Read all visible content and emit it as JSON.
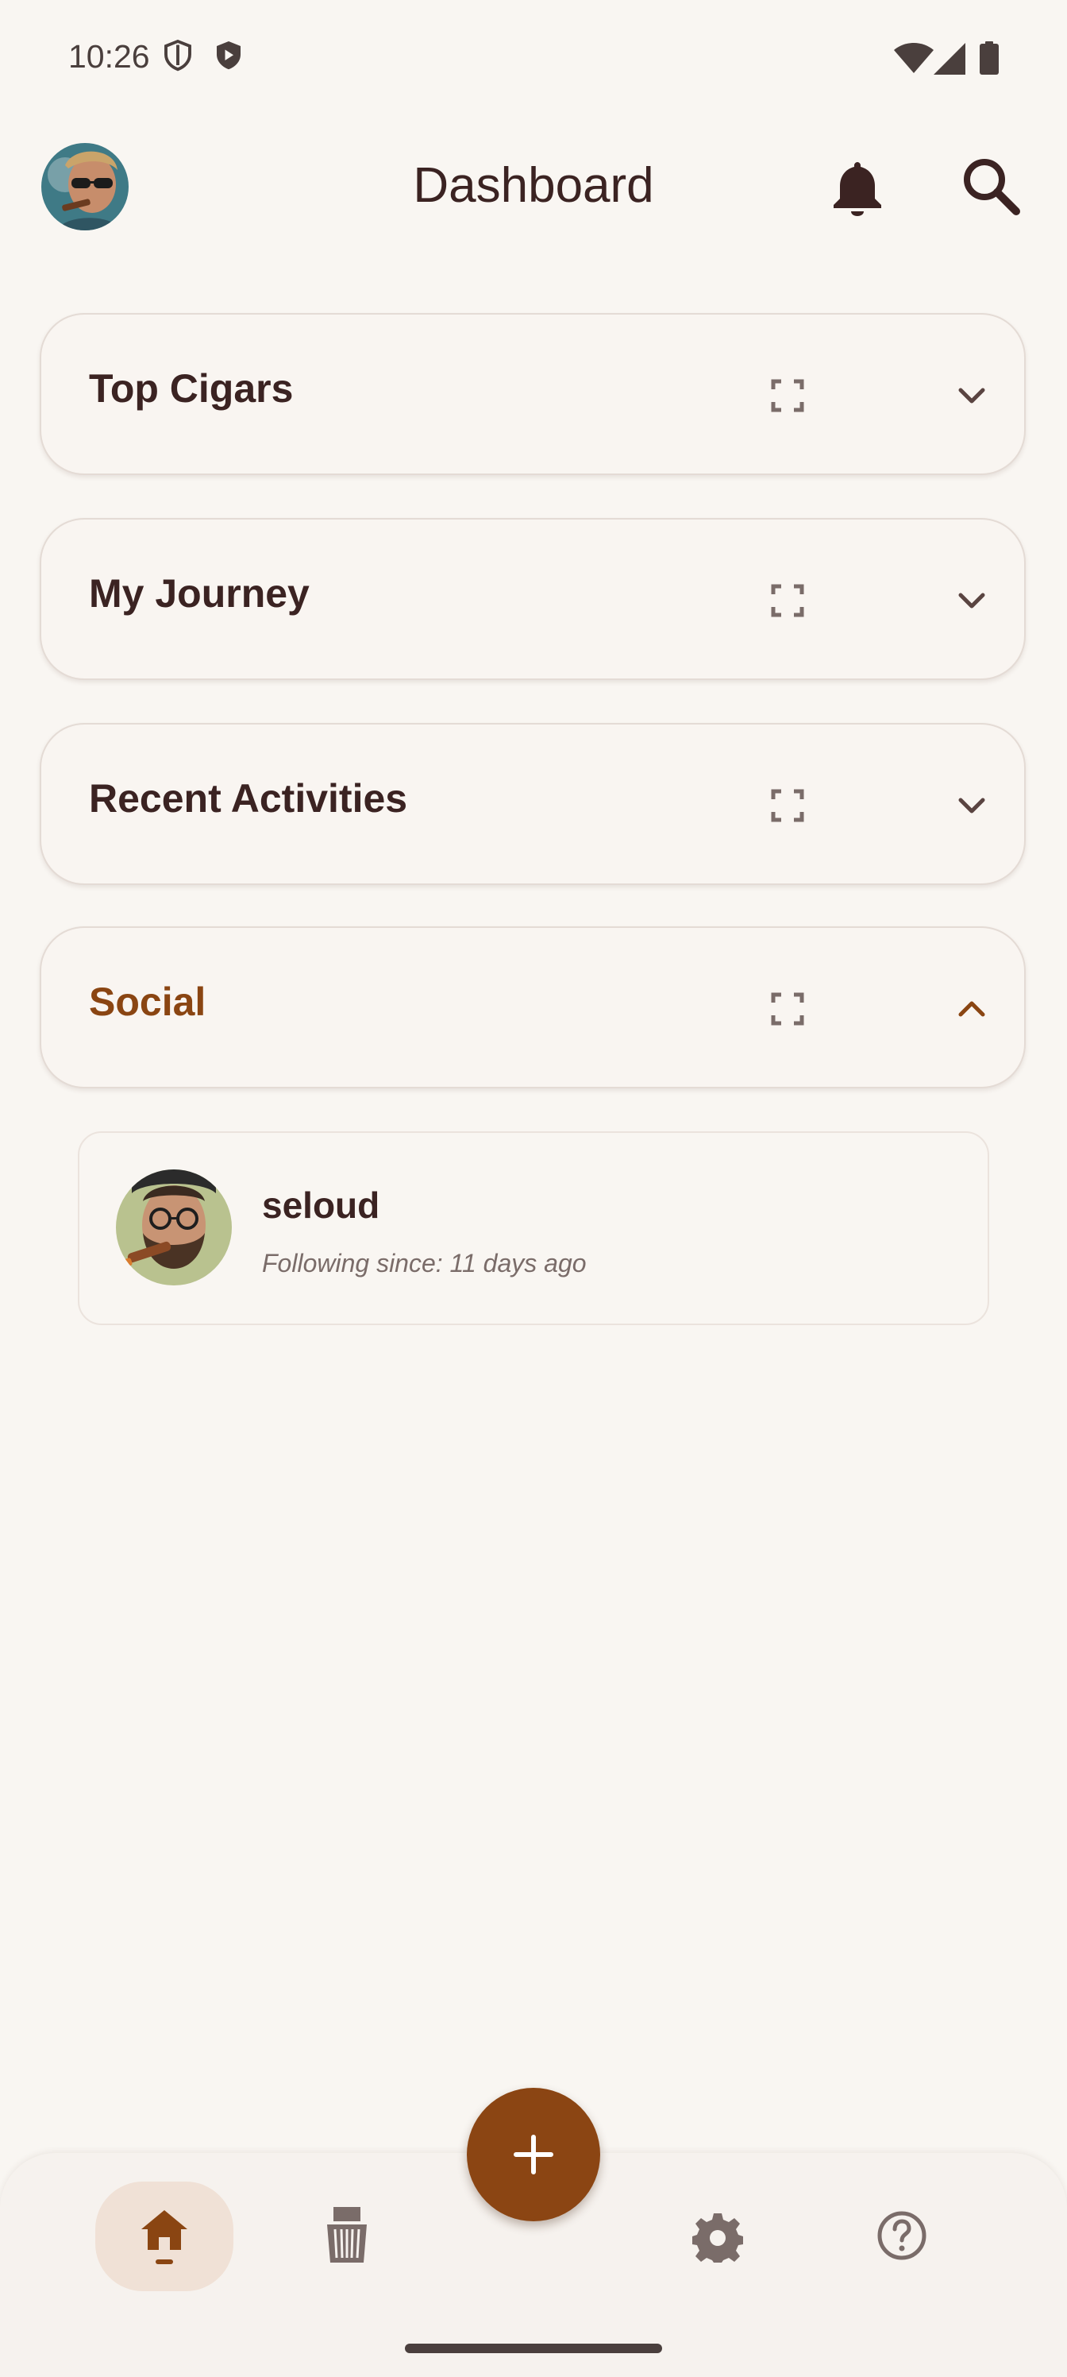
{
  "status_bar": {
    "time": "10:26",
    "icons": [
      "shield-outline-icon",
      "shield-play-icon",
      "wifi-icon",
      "cellular-signal-icon",
      "battery-icon"
    ]
  },
  "app_bar": {
    "title": "Dashboard",
    "avatar": "user-avatar-cigar-sunglasses",
    "actions": [
      "bell-icon",
      "search-icon"
    ]
  },
  "sections": [
    {
      "title": "Top Cigars",
      "expanded": false,
      "icons": [
        "expand-icon",
        "chevron-down-icon"
      ]
    },
    {
      "title": "My Journey",
      "expanded": false,
      "icons": [
        "expand-icon",
        "chevron-down-icon"
      ]
    },
    {
      "title": "Recent Activities",
      "expanded": false,
      "icons": [
        "expand-icon",
        "chevron-down-icon"
      ]
    },
    {
      "title": "Social",
      "expanded": true,
      "icons": [
        "expand-icon",
        "chevron-up-icon"
      ]
    }
  ],
  "social": {
    "items": [
      {
        "username": "seloud",
        "following": "Following since: 11 days ago",
        "avatar": "bearded-man-cigar-avatar"
      }
    ]
  },
  "bottom_nav": {
    "items": [
      "home-icon",
      "humidor-icon",
      "settings-icon",
      "help-icon"
    ],
    "selected": "home-icon",
    "fab_icon": "plus-icon"
  },
  "colors": {
    "accent": "#8b4513",
    "background": "#f9f6f2",
    "text": "#3b2322",
    "nav_selected_bg": "#f0e1d6"
  }
}
